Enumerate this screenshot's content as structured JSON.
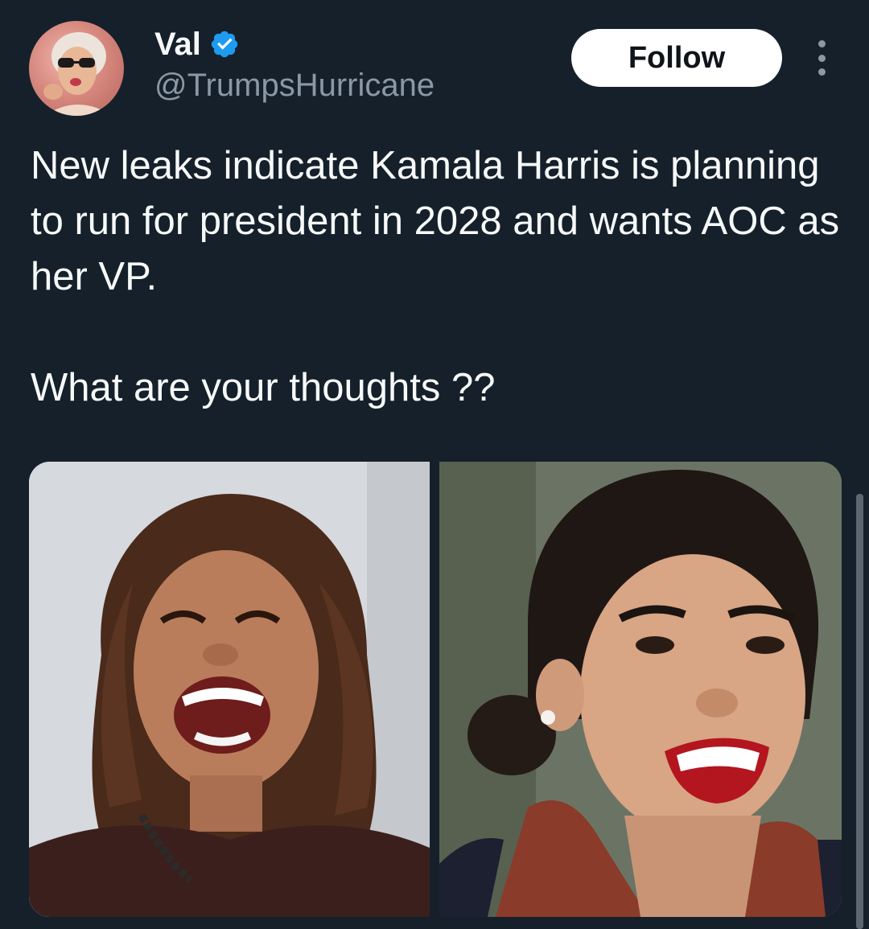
{
  "author": {
    "display_name": "Val",
    "handle": "@TrumpsHurricane",
    "verified": true,
    "verified_color": "#1d9bf0",
    "avatar_icon": "profile-photo"
  },
  "actions": {
    "follow_label": "Follow",
    "more_icon": "more-options-icon"
  },
  "tweet": {
    "lines": [
      "New leaks indicate Kamala Harris is planning to run for president in 2028 and wants AOC as her VP.",
      "What are your thoughts ??"
    ]
  },
  "media": {
    "photos": [
      {
        "icon": "photo-kamala-harris"
      },
      {
        "icon": "photo-aoc"
      }
    ]
  },
  "colors": {
    "background": "#15202b",
    "text": "#f7f9f9",
    "secondary_text": "#8b98a5",
    "follow_bg": "#ffffff",
    "follow_text": "#0f1419"
  }
}
